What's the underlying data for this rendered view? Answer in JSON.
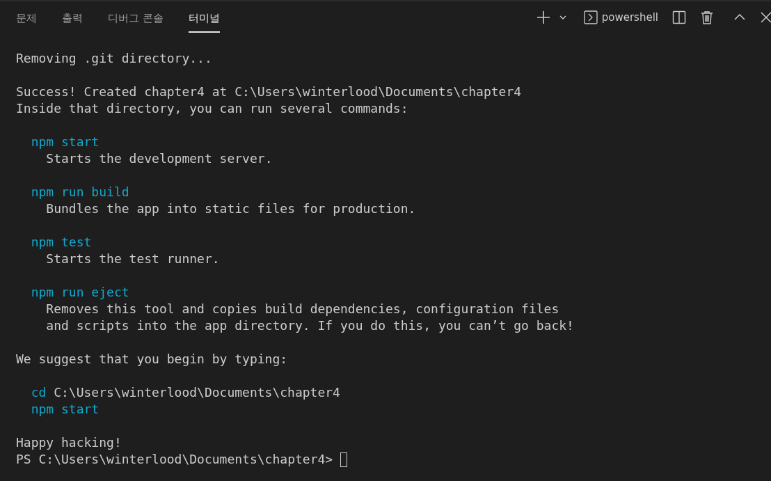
{
  "tabs": [
    {
      "label": "문제",
      "selected": false
    },
    {
      "label": "출력",
      "selected": false
    },
    {
      "label": "디버그 콘솔",
      "selected": false
    },
    {
      "label": "터미널",
      "selected": true
    }
  ],
  "toolbar": {
    "shell": "powershell"
  },
  "terminal": {
    "lines": [
      {
        "kind": "text",
        "parts": [
          {
            "kind": "plain",
            "text": "Removing .git directory..."
          }
        ]
      },
      {
        "kind": "blank"
      },
      {
        "kind": "text",
        "parts": [
          {
            "kind": "plain",
            "text": "Success! Created chapter4 at C:\\Users\\winterlood\\Documents\\chapter4"
          }
        ]
      },
      {
        "kind": "text",
        "parts": [
          {
            "kind": "plain",
            "text": "Inside that directory, you can run several commands:"
          }
        ]
      },
      {
        "kind": "blank"
      },
      {
        "kind": "command",
        "parts": [
          {
            "kind": "command",
            "text": "npm start"
          }
        ]
      },
      {
        "kind": "detail",
        "parts": [
          {
            "kind": "plain",
            "text": "Starts the development server."
          }
        ]
      },
      {
        "kind": "blank"
      },
      {
        "kind": "command",
        "parts": [
          {
            "kind": "command",
            "text": "npm run build"
          }
        ]
      },
      {
        "kind": "detail",
        "parts": [
          {
            "kind": "plain",
            "text": "Bundles the app into static files for production."
          }
        ]
      },
      {
        "kind": "blank"
      },
      {
        "kind": "command",
        "parts": [
          {
            "kind": "command",
            "text": "npm test"
          }
        ]
      },
      {
        "kind": "detail",
        "parts": [
          {
            "kind": "plain",
            "text": "Starts the test runner."
          }
        ]
      },
      {
        "kind": "blank"
      },
      {
        "kind": "command",
        "parts": [
          {
            "kind": "command",
            "text": "npm run eject"
          }
        ]
      },
      {
        "kind": "detail",
        "parts": [
          {
            "kind": "plain",
            "text": "Removes this tool and copies build dependencies, configuration files"
          }
        ]
      },
      {
        "kind": "detail",
        "parts": [
          {
            "kind": "plain",
            "text": "and scripts into the app directory. If you do this, you can’t go back!"
          }
        ]
      },
      {
        "kind": "blank"
      },
      {
        "kind": "text",
        "parts": [
          {
            "kind": "plain",
            "text": "We suggest that you begin by typing:"
          }
        ]
      },
      {
        "kind": "blank"
      },
      {
        "kind": "command",
        "parts": [
          {
            "kind": "command",
            "text": "cd"
          },
          {
            "kind": "plain",
            "text": "C:\\Users\\winterlood\\Documents\\chapter4"
          }
        ]
      },
      {
        "kind": "command",
        "parts": [
          {
            "kind": "command",
            "text": "npm start"
          }
        ]
      },
      {
        "kind": "blank"
      },
      {
        "kind": "text",
        "parts": [
          {
            "kind": "plain",
            "text": "Happy hacking!"
          }
        ]
      },
      {
        "kind": "prompt",
        "parts": [
          {
            "kind": "plain",
            "text": "PS C:\\Users\\winterlood\\Documents\\chapter4>"
          }
        ]
      }
    ]
  }
}
